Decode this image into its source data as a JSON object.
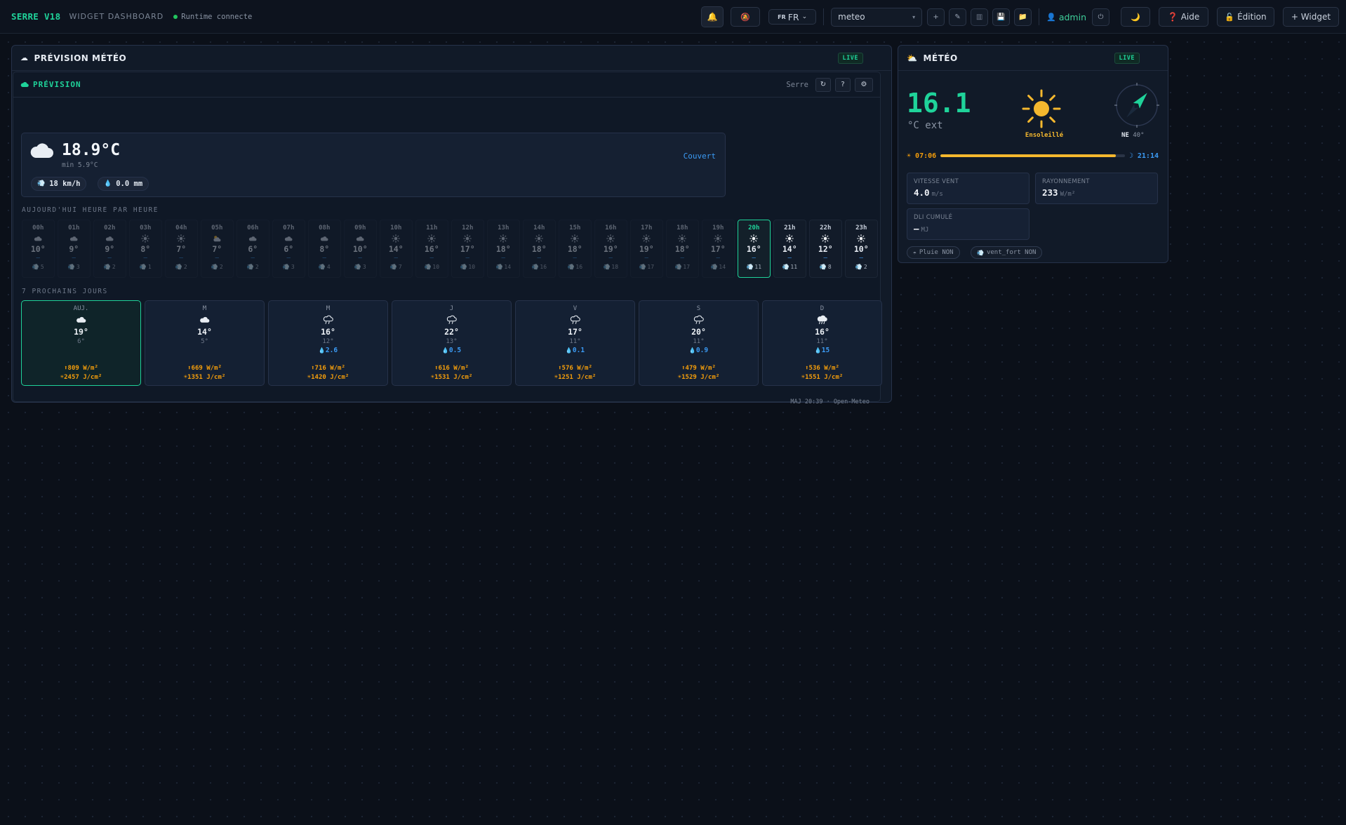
{
  "app": {
    "brand": "SERRE V18",
    "subtitle": "WIDGET DASHBOARD",
    "status": "Runtime connecte"
  },
  "toolbar": {
    "lang_flag": "FR",
    "lang_value": "FR",
    "view_value": "meteo",
    "user": "admin",
    "help_label": "Aide",
    "edit_label": "Édition",
    "widget_label": "+ Widget"
  },
  "forecast_panel": {
    "title": "PRÉVISION MÉTÉO",
    "live": "LIVE",
    "subtitle": "PRÉVISION",
    "location": "Serre",
    "refresh_label": "↻",
    "help_label": "?",
    "current": {
      "temp": "18.9°C",
      "min": "min 5.9°C",
      "condition": "Couvert",
      "wind": "18 km/h",
      "rain": "0.0 mm"
    },
    "hourly_label": "AUJOURD'HUI HEURE PAR HEURE",
    "hours": [
      {
        "h": "00h",
        "icon": "cloud",
        "t": "10°",
        "r": "—",
        "w": "5",
        "state": "past"
      },
      {
        "h": "01h",
        "icon": "cloud",
        "t": "9°",
        "r": "—",
        "w": "3",
        "state": "past"
      },
      {
        "h": "02h",
        "icon": "cloud",
        "t": "9°",
        "r": "—",
        "w": "2",
        "state": "past"
      },
      {
        "h": "03h",
        "icon": "sun",
        "t": "8°",
        "r": "—",
        "w": "1",
        "state": "past"
      },
      {
        "h": "04h",
        "icon": "sun",
        "t": "7°",
        "r": "—",
        "w": "2",
        "state": "past"
      },
      {
        "h": "05h",
        "icon": "partly",
        "t": "7°",
        "r": "—",
        "w": "2",
        "state": "past"
      },
      {
        "h": "06h",
        "icon": "cloud",
        "t": "6°",
        "r": "—",
        "w": "2",
        "state": "past"
      },
      {
        "h": "07h",
        "icon": "cloud",
        "t": "6°",
        "r": "—",
        "w": "3",
        "state": "past"
      },
      {
        "h": "08h",
        "icon": "cloud",
        "t": "8°",
        "r": "—",
        "w": "4",
        "state": "past"
      },
      {
        "h": "09h",
        "icon": "cloud",
        "t": "10°",
        "r": "—",
        "w": "3",
        "state": "past"
      },
      {
        "h": "10h",
        "icon": "sun",
        "t": "14°",
        "r": "—",
        "w": "7",
        "state": "past"
      },
      {
        "h": "11h",
        "icon": "sun",
        "t": "16°",
        "r": "—",
        "w": "10",
        "state": "past"
      },
      {
        "h": "12h",
        "icon": "sun",
        "t": "17°",
        "r": "—",
        "w": "10",
        "state": "past"
      },
      {
        "h": "13h",
        "icon": "sun",
        "t": "18°",
        "r": "—",
        "w": "14",
        "state": "past"
      },
      {
        "h": "14h",
        "icon": "sun",
        "t": "18°",
        "r": "—",
        "w": "16",
        "state": "past"
      },
      {
        "h": "15h",
        "icon": "sun",
        "t": "18°",
        "r": "—",
        "w": "16",
        "state": "past"
      },
      {
        "h": "16h",
        "icon": "sun",
        "t": "19°",
        "r": "—",
        "w": "18",
        "state": "past"
      },
      {
        "h": "17h",
        "icon": "sun",
        "t": "19°",
        "r": "—",
        "w": "17",
        "state": "past"
      },
      {
        "h": "18h",
        "icon": "sun",
        "t": "18°",
        "r": "—",
        "w": "17",
        "state": "past"
      },
      {
        "h": "19h",
        "icon": "sun",
        "t": "17°",
        "r": "—",
        "w": "14",
        "state": "past"
      },
      {
        "h": "20h",
        "icon": "sun",
        "t": "16°",
        "r": "—",
        "w": "11",
        "state": "now"
      },
      {
        "h": "21h",
        "icon": "sun",
        "t": "14°",
        "r": "—",
        "w": "11",
        "state": "future"
      },
      {
        "h": "22h",
        "icon": "sun",
        "t": "12°",
        "r": "—",
        "w": "8",
        "state": "future"
      },
      {
        "h": "23h",
        "icon": "sun",
        "t": "10°",
        "r": "—",
        "w": "2",
        "state": "future"
      }
    ],
    "daily_label": "7 PROCHAINS JOURS",
    "days": [
      {
        "d": "AUJ.",
        "icon": "cloud",
        "max": "19°",
        "min": "6°",
        "rain": "",
        "rad": "⬆809 W/m²",
        "dli": "☀2457 J/cm²",
        "today": true
      },
      {
        "d": "M",
        "icon": "cloud",
        "max": "14°",
        "min": "5°",
        "rain": "",
        "rad": "⬆669 W/m²",
        "dli": "☀1351 J/cm²",
        "today": false
      },
      {
        "d": "M",
        "icon": "rain",
        "max": "16°",
        "min": "12°",
        "rain": "2.6",
        "rad": "⬆716 W/m²",
        "dli": "☀1420 J/cm²",
        "today": false
      },
      {
        "d": "J",
        "icon": "rain",
        "max": "22°",
        "min": "13°",
        "rain": "0.5",
        "rad": "⬆616 W/m²",
        "dli": "☀1531 J/cm²",
        "today": false
      },
      {
        "d": "V",
        "icon": "rain",
        "max": "17°",
        "min": "11°",
        "rain": "0.1",
        "rad": "⬆576 W/m²",
        "dli": "☀1251 J/cm²",
        "today": false
      },
      {
        "d": "S",
        "icon": "rain",
        "max": "20°",
        "min": "11°",
        "rain": "0.9",
        "rad": "⬆479 W/m²",
        "dli": "☀1529 J/cm²",
        "today": false
      },
      {
        "d": "D",
        "icon": "rain-heavy",
        "max": "16°",
        "min": "11°",
        "rain": "15",
        "rad": "⬆536 W/m²",
        "dli": "☀1551 J/cm²",
        "today": false
      }
    ],
    "updated": "MAJ 20:39 · Open-Meteo"
  },
  "meteo_panel": {
    "title": "MÉTÉO",
    "live": "LIVE",
    "temp": "16.1",
    "unit": "°C ext",
    "condition": "Ensoleillé",
    "wind_dir": "NE",
    "wind_deg": "40°",
    "wind_deg_value": 40,
    "sunrise": "07:06",
    "sunset": "21:14",
    "day_progress": 0.95,
    "stats": {
      "wind_label": "VITESSE VENT",
      "wind_value": "4.0",
      "wind_unit": "m/s",
      "rad_label": "RAYONNEMENT",
      "rad_value": "233",
      "rad_unit": "W/m²",
      "dli_label": "DLI CUMULÉ",
      "dli_value": "—",
      "dli_unit": "MJ"
    },
    "flags": {
      "rain": "Pluie NON",
      "wind": "vent_fort NON"
    }
  },
  "colors": {
    "accent": "#1fd39a",
    "rain": "#3b9bf5",
    "sun": "#f5b82e",
    "radiation": "#f59e0b"
  }
}
